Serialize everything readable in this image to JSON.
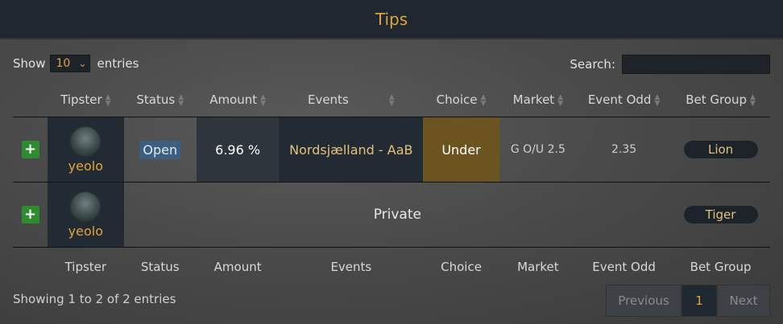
{
  "header": {
    "title": "Tips"
  },
  "length": {
    "show_label": "Show",
    "value": "10",
    "entries_label": "entries"
  },
  "search": {
    "label": "Search:",
    "value": ""
  },
  "columns": [
    "Tipster",
    "Status",
    "Amount",
    "Events",
    "Choice",
    "Market",
    "Event Odd",
    "Bet Group"
  ],
  "rows": [
    {
      "tipster": "yeolo",
      "status": "Open",
      "amount": "6.96 %",
      "events": "Nordsjælland - AaB",
      "choice": "Under",
      "market": "G O/U 2.5",
      "odd": "2.35",
      "group": "Lion"
    },
    {
      "tipster": "yeolo",
      "private": "Private",
      "group": "Tiger"
    }
  ],
  "footer": {
    "info": "Showing 1 to 2 of 2 entries"
  },
  "pagination": {
    "previous": "Previous",
    "current": "1",
    "next": "Next"
  },
  "colors": {
    "accent": "#e2a33a",
    "header_bg": "#1f2730",
    "status_open": "#3a5f82",
    "choice_bg": "#6b5420"
  }
}
